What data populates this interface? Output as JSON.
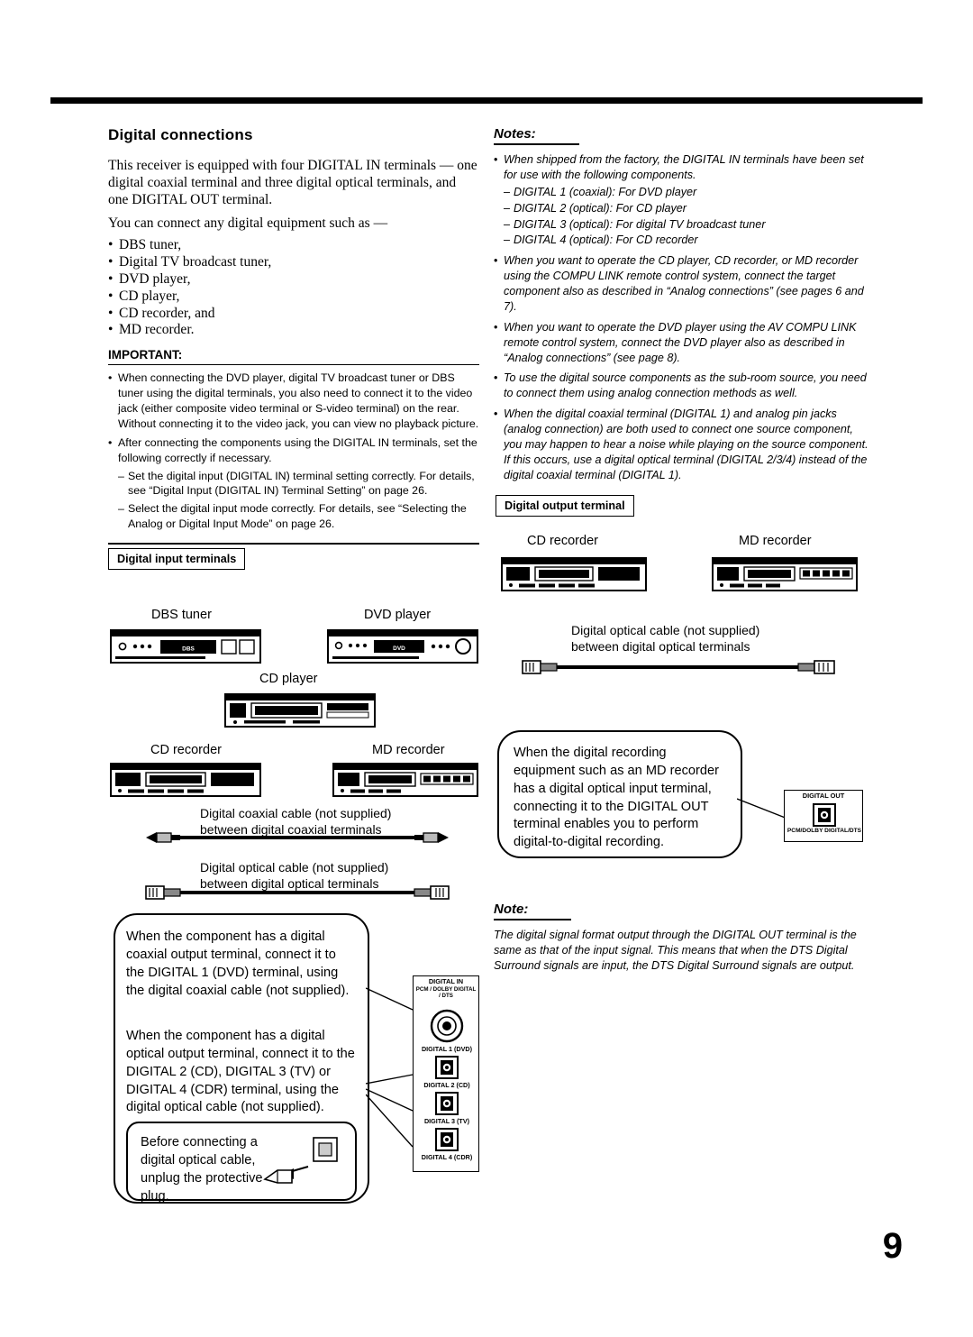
{
  "page": {
    "number": "9"
  },
  "left": {
    "section_title": "Digital connections",
    "intro1": "This receiver is equipped with four DIGITAL IN terminals — one digital coaxial terminal and three digital optical terminals, and one DIGITAL OUT terminal.",
    "intro2": "You can connect any digital equipment such as —",
    "equipment": [
      "DBS tuner,",
      "Digital TV broadcast tuner,",
      "DVD player,",
      "CD player,",
      "CD recorder, and",
      "MD recorder."
    ],
    "important_heading": "IMPORTANT:",
    "important_items": [
      "When connecting the DVD player, digital TV broadcast tuner or DBS tuner using the digital terminals, you also need to connect it to the video jack (either composite video terminal or S-video terminal) on the rear. Without connecting it to the video jack, you can view no playback picture.",
      "After connecting the components using the DIGITAL IN terminals, set the following correctly if necessary."
    ],
    "important_subitems": [
      "Set the digital input (DIGITAL IN) terminal setting correctly. For details, see “Digital Input (DIGITAL IN) Terminal Setting” on page 26.",
      "Select the digital input mode correctly. For details, see “Selecting the Analog or Digital Input Mode” on page 26."
    ],
    "digital_input_box": "Digital input terminals",
    "devices": {
      "dbs_tuner": "DBS tuner",
      "dvd_player": "DVD player",
      "cd_player": "CD player",
      "cd_recorder": "CD recorder",
      "md_recorder": "MD recorder"
    },
    "coax_cable_label_l1": "Digital coaxial cable (not supplied)",
    "coax_cable_label_l2": "between digital coaxial terminals",
    "opt_cable_label_l1": "Digital optical cable (not supplied)",
    "opt_cable_label_l2": "between digital optical terminals",
    "balloon1": "When the component has a digital coaxial output terminal, connect it to the DIGITAL 1 (DVD) terminal, using the digital coaxial cable (not supplied).",
    "balloon2": "When the component has a digital optical output terminal, connect it to the DIGITAL 2 (CD), DIGITAL 3 (TV) or DIGITAL 4 (CDR) terminal, using the digital optical cable (not supplied).",
    "balloon3": "Before connecting a digital optical cable, unplug the protective plug."
  },
  "terminals_in": {
    "title_line1": "DIGITAL IN",
    "title_line2": "PCM / DOLBY DIGITAL",
    "title_line3": "/ DTS",
    "labels": [
      "DIGITAL 1 (DVD)",
      "DIGITAL 2 (CD)",
      "DIGITAL 3 (TV)",
      "DIGITAL 4 (CDR)"
    ]
  },
  "terminals_out": {
    "title": "DIGITAL OUT",
    "label": "PCM/DOLBY DIGITAL/DTS"
  },
  "right": {
    "notes_title": "Notes:",
    "notes": [
      {
        "text": "When shipped from the factory, the DIGITAL IN terminals have been set for use with the following components.",
        "sub": [
          "DIGITAL 1 (coaxial): For DVD player",
          "DIGITAL 2 (optical): For CD player",
          "DIGITAL 3 (optical): For digital TV broadcast tuner",
          "DIGITAL 4 (optical): For CD recorder"
        ]
      },
      {
        "text": "When you want to operate the CD player, CD recorder, or MD recorder using the COMPU LINK remote control system, connect the target component also as described in “Analog connections” (see pages 6 and 7).",
        "sub": []
      },
      {
        "text": "When you want to operate the DVD player using the AV COMPU LINK remote control system, connect the DVD player also as described in “Analog connections” (see page 8).",
        "sub": []
      },
      {
        "text": "To use the digital source components as the sub-room source, you need to connect them using analog connection methods as well.",
        "sub": []
      },
      {
        "text": "When the digital coaxial terminal (DIGITAL 1) and analog pin jacks (analog connection) are both used to connect one source component, you may happen to hear a noise while playing on the source component. If this occurs, use a digital optical terminal (DIGITAL 2/3/4) instead of the digital coaxial terminal (DIGITAL 1).",
        "sub": []
      }
    ],
    "digital_output_box": "Digital output terminal",
    "devices": {
      "cd_recorder": "CD recorder",
      "md_recorder": "MD recorder"
    },
    "opt_cable_label_l1": "Digital optical cable (not supplied)",
    "opt_cable_label_l2": "between digital optical terminals",
    "balloon": "When the digital recording equipment such as an MD recorder has a digital optical input terminal, connecting it to the DIGITAL OUT terminal enables you to perform digital-to-digital recording.",
    "note_title": "Note:",
    "note_body": "The digital signal format output through the DIGITAL OUT terminal is the same as that of the input signal. This means that when the DTS Digital Surround signals are input, the DTS Digital Surround signals are output."
  }
}
